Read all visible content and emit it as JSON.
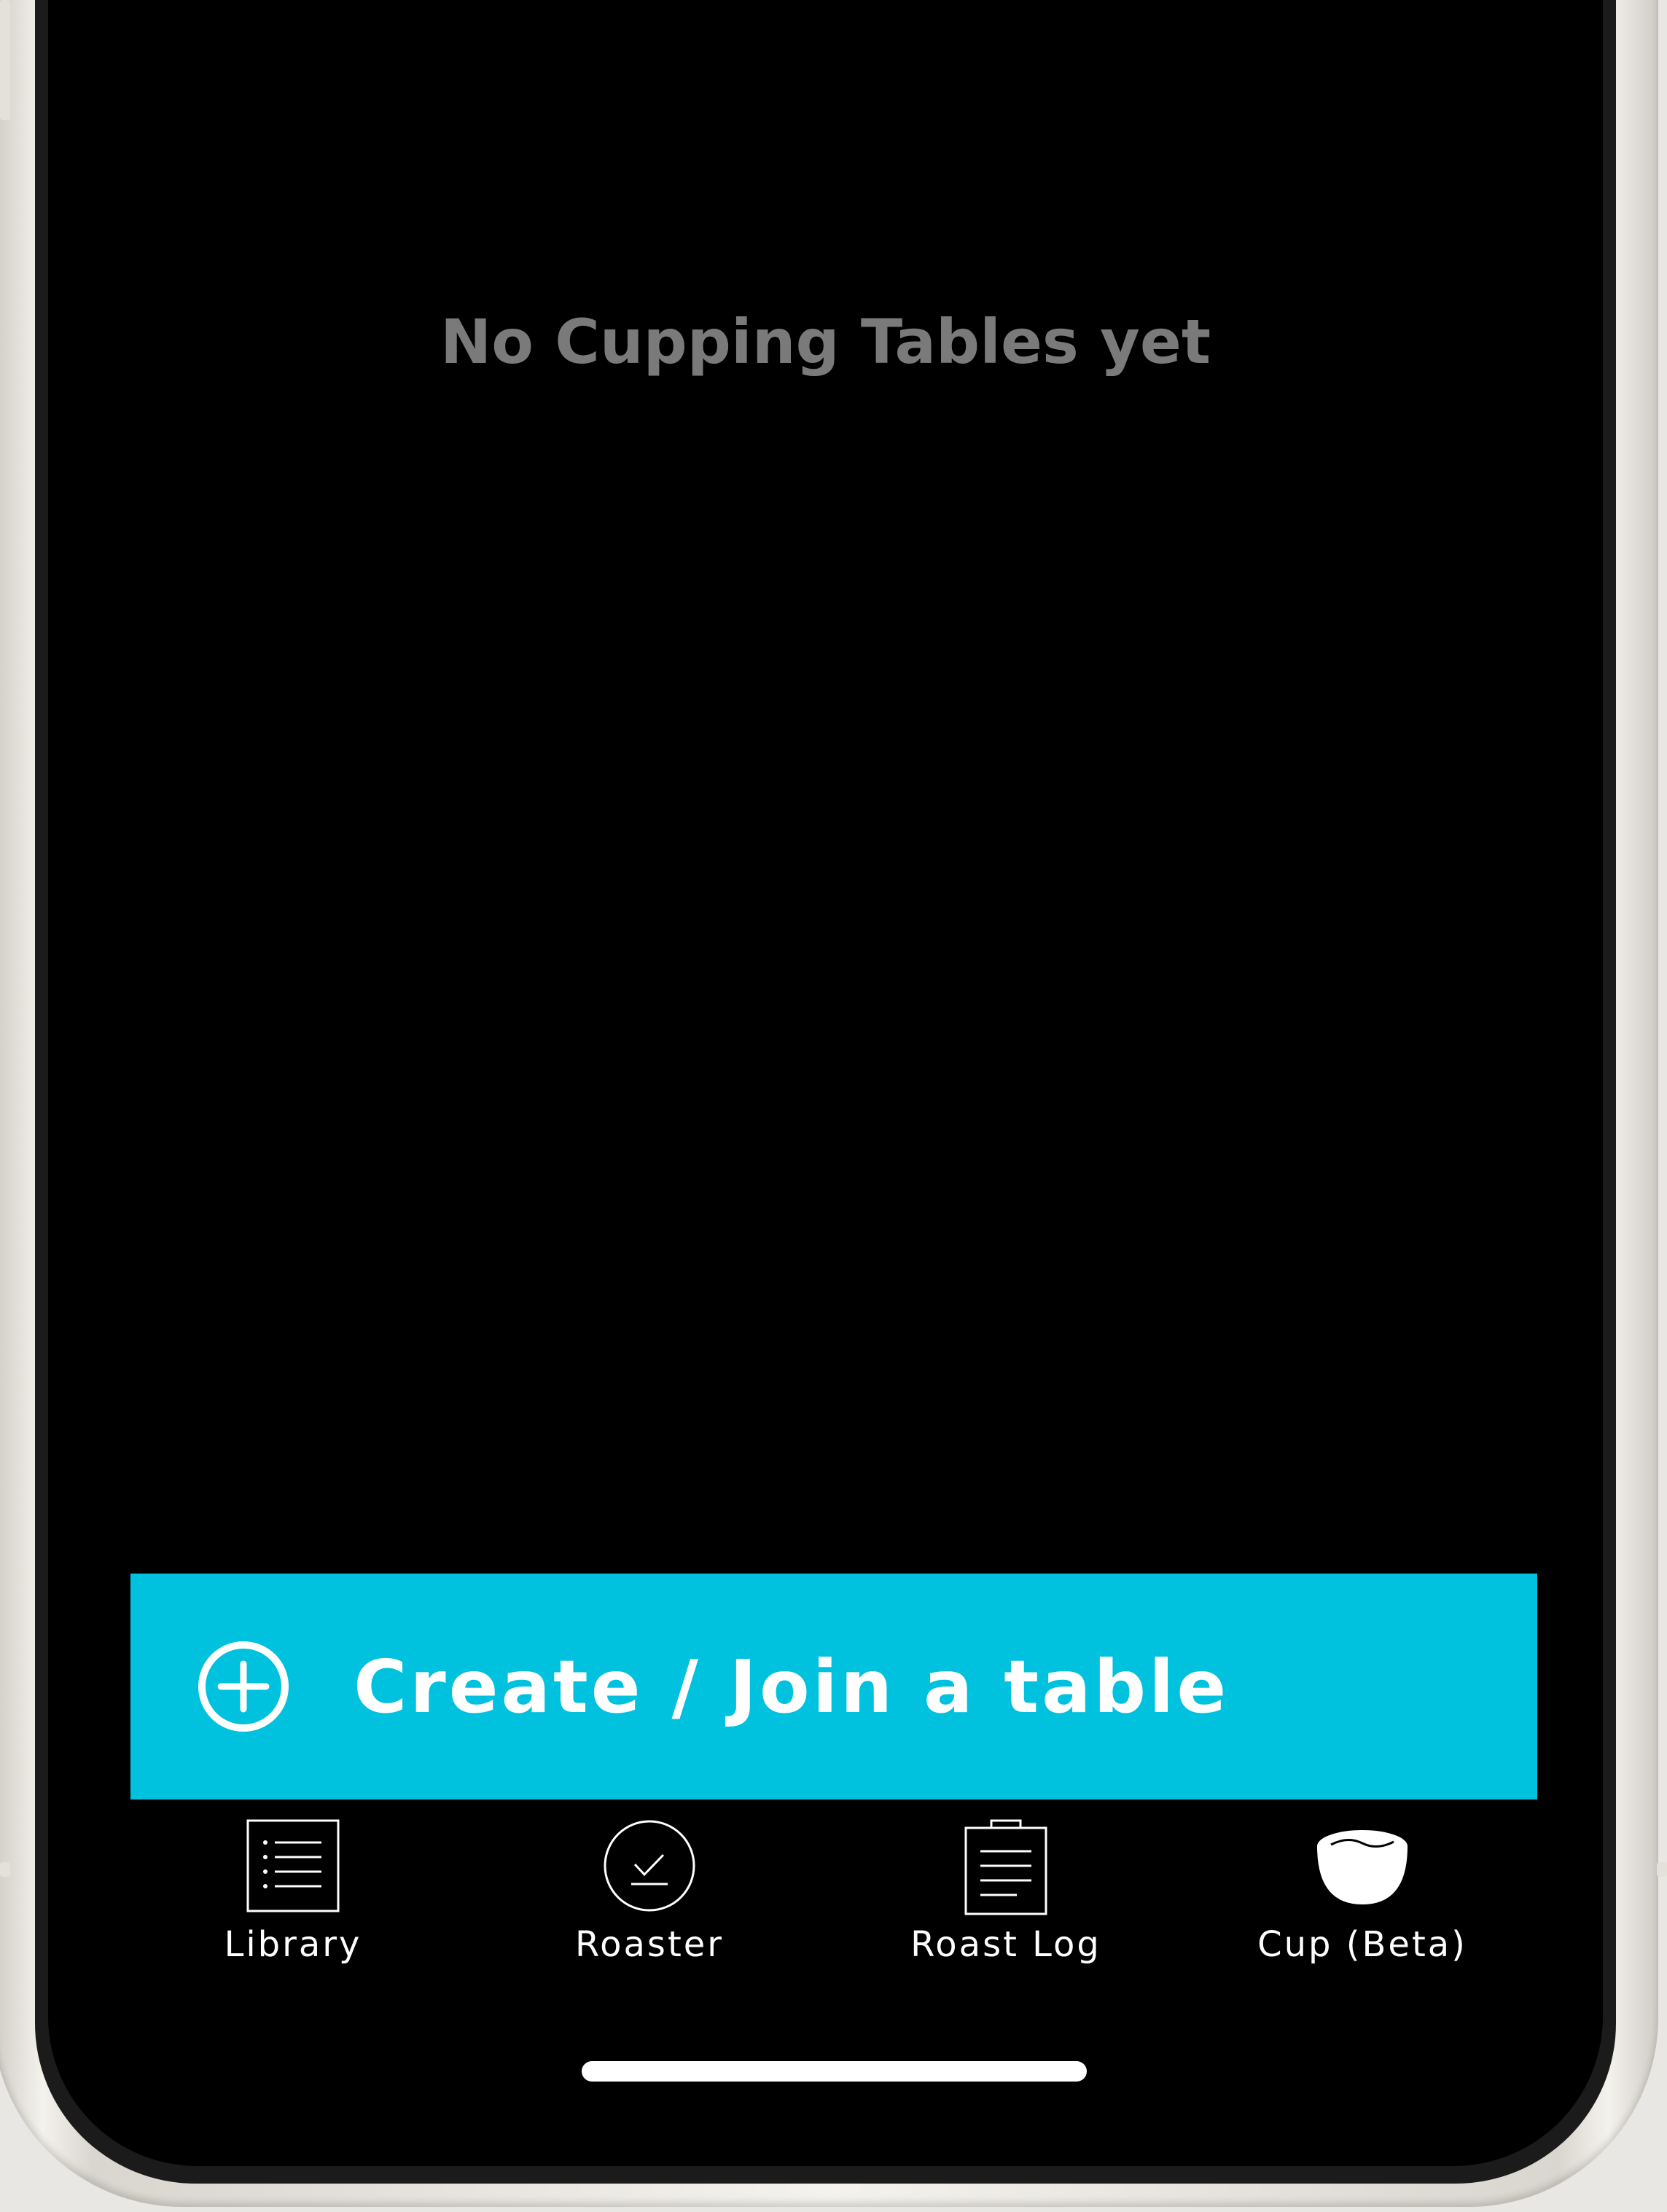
{
  "empty_state": {
    "message": "No Cupping Tables yet"
  },
  "cta": {
    "label": "Create / Join a table",
    "icon": "plus-circle-icon",
    "color": "#00c2df"
  },
  "tabbar": {
    "items": [
      {
        "label": "Library",
        "icon": "list-icon",
        "selected": false
      },
      {
        "label": "Roaster",
        "icon": "check-circle-icon",
        "selected": false
      },
      {
        "label": "Roast Log",
        "icon": "clipboard-icon",
        "selected": false
      },
      {
        "label": "Cup (Beta)",
        "icon": "cup-bowl-icon",
        "selected": true
      }
    ]
  },
  "colors": {
    "screen_background": "#000000",
    "empty_text": "#7a7a7a",
    "accent": "#00c2df",
    "tab_text": "#ffffff"
  }
}
